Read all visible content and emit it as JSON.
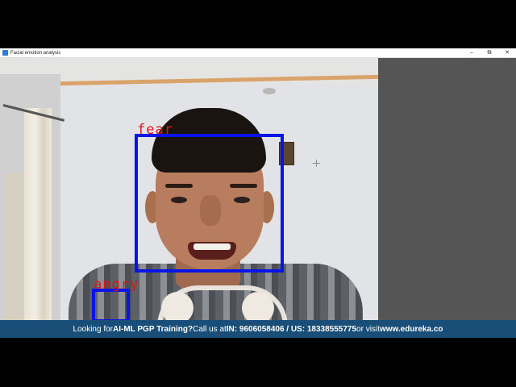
{
  "window": {
    "title": "Facial emotion analysis",
    "controls": {
      "minimize": "–",
      "maximize": "⧉",
      "close": "✕"
    }
  },
  "detections": [
    {
      "label": "fear"
    },
    {
      "label": "angry"
    }
  ],
  "colors": {
    "box": "#0a14e6",
    "label": "#e01414",
    "banner_bg": "#184e77",
    "side_pane": "#555555"
  },
  "banner": {
    "prefix": "Looking for ",
    "course": "AI-ML PGP Training?",
    "middle": " Call us at ",
    "phone_in": "IN: 9606058406 / US: 18338555775",
    "or_visit": " or visit ",
    "website": "www.edureka.co"
  }
}
